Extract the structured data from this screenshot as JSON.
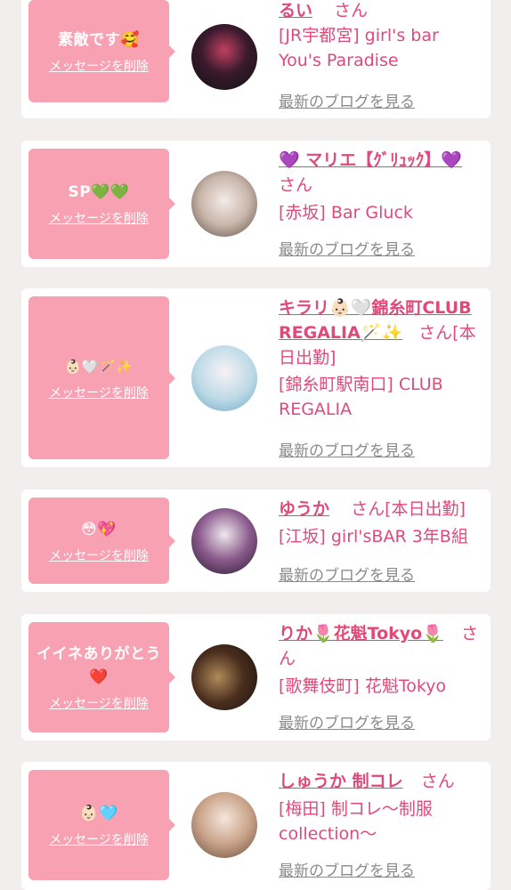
{
  "delete_label": "メッセージを削除",
  "blog_label": "最新のブログを見る",
  "entries": [
    {
      "message": "素敵です🥰",
      "name": "るい",
      "suffix": "さん",
      "shop": "[JR宇都宮] girl's bar You's Paradise"
    },
    {
      "message": "SP💚💚",
      "name": "💜 マリエ【ｸﾞﾘｭｯｸ】💜",
      "suffix": "さん",
      "shop": "[赤坂] Bar Gluck"
    },
    {
      "message": "👶🏻🤍🪄✨",
      "name": "キラリ👶🏻🤍錦糸町CLUB REGALIA🪄✨",
      "suffix": "さん[本日出勤]",
      "shop": "[錦糸町駅南口] CLUB REGALIA"
    },
    {
      "message": "😳💖",
      "name": "ゆうか",
      "suffix": "さん[本日出勤]",
      "shop": "[江坂] girl'sBAR 3年B組"
    },
    {
      "message": "イイネありがとう❤️",
      "name": "りか🌷花魁Tokyo🌷",
      "suffix": "さん",
      "shop": "[歌舞伎町] 花魁Tokyo"
    },
    {
      "message": "👶🏻🩵",
      "name": "しゅうか 制コレ",
      "suffix": "さん",
      "shop": "[梅田] 制コレ〜制服collection〜"
    }
  ],
  "colors": {
    "accent": "#e04a79",
    "bubble": "#f8a1b3",
    "background": "#f2eeee"
  }
}
